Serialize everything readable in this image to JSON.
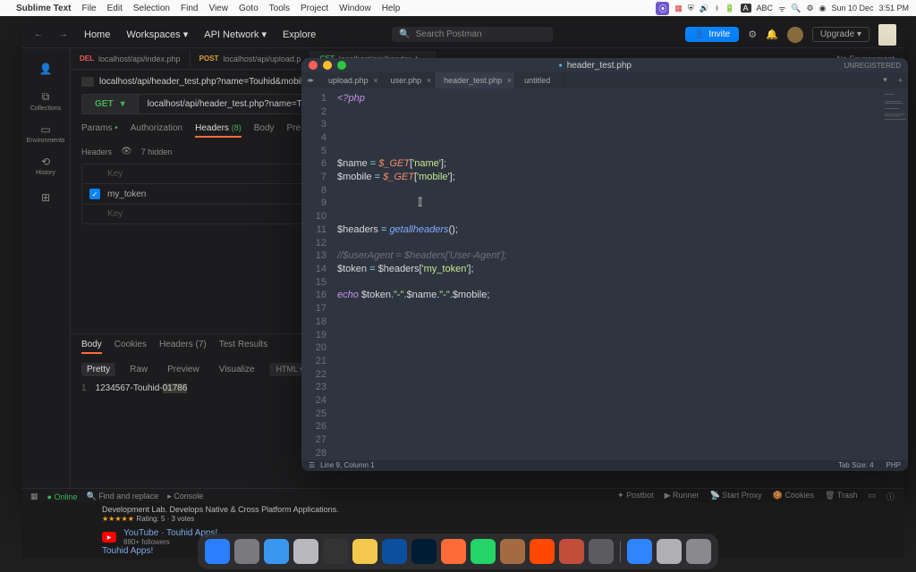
{
  "menubar": {
    "app": "Sublime Text",
    "items": [
      "File",
      "Edit",
      "Selection",
      "Find",
      "View",
      "Goto",
      "Tools",
      "Project",
      "Window",
      "Help"
    ],
    "date": "Sun 10 Dec",
    "time": "3:51 PM",
    "lang": "A",
    "input": "ABC"
  },
  "postman": {
    "nav": {
      "home": "Home",
      "workspaces": "Workspaces",
      "api": "API Network",
      "explore": "Explore"
    },
    "search_placeholder": "Search Postman",
    "invite": "Invite",
    "upgrade": "Upgrade",
    "sidebar": [
      {
        "glyph": "⧉",
        "label": "Collections"
      },
      {
        "glyph": "▭",
        "label": "Environments"
      },
      {
        "glyph": "⟲",
        "label": "History"
      },
      {
        "glyph": "⊞",
        "label": ""
      }
    ],
    "tabs": [
      {
        "method": "DEL",
        "cls": "method-del",
        "label": "localhost/api/index.php"
      },
      {
        "method": "POST",
        "cls": "method-post",
        "label": "localhost/api/upload.p"
      },
      {
        "method": "GET",
        "cls": "method-get",
        "label": "localhost/api/header_t…",
        "active": true
      }
    ],
    "env": "No Environment",
    "breadcrumb": "localhost/api/header_test.php?name=Touhid&mobile=01786",
    "method": "GET",
    "url": "localhost/api/header_test.php?name=Touhid&mobile=01786",
    "subtabs": [
      "Params",
      "Authorization",
      "Headers",
      "Body",
      "Pre-requ"
    ],
    "headers_count": "(8)",
    "headers_label": "Headers",
    "hidden_label": "7 hidden",
    "header_rows": [
      {
        "key_label": "Key",
        "placeholder": true,
        "checked": false
      },
      {
        "key_label": "my_token",
        "placeholder": false,
        "checked": true
      },
      {
        "key_label": "Key",
        "placeholder": true,
        "checked": false
      }
    ],
    "resp_tabs": [
      "Body",
      "Cookies",
      "Headers (7)",
      "Test Results"
    ],
    "resp_toolbar": {
      "pretty": "Pretty",
      "raw": "Raw",
      "preview": "Preview",
      "visualize": "Visualize",
      "format": "HTML"
    },
    "resp_body": {
      "line": "1",
      "text_a": "1234567-Touhid-",
      "text_hl": "01786"
    },
    "footer": {
      "online": "Online",
      "find": "Find and replace",
      "console": "Console",
      "postbot": "Postbot",
      "runner": "Runner",
      "proxy": "Start Proxy",
      "cookies": "Cookies",
      "trash": "Trash"
    }
  },
  "sublime": {
    "title_file": "header_test.php",
    "unreg": "UNREGISTERED",
    "tabs": [
      {
        "label": "upload.php",
        "active": false
      },
      {
        "label": "user.php",
        "active": false
      },
      {
        "label": "header_test.php",
        "active": true
      },
      {
        "label": "untitled",
        "active": false
      }
    ],
    "lines": [
      "1",
      "2",
      "3",
      "4",
      "5",
      "6",
      "7",
      "8",
      "9",
      "10",
      "11",
      "12",
      "13",
      "14",
      "15",
      "16",
      "17",
      "18",
      "19",
      "20",
      "21",
      "22",
      "23",
      "24",
      "25",
      "26",
      "27",
      "28"
    ],
    "code": {
      "l1_open": "<?php",
      "l6_var": "$name",
      "l6_get": "$_GET",
      "l6_key": "'name'",
      "l7_var": "$mobile",
      "l7_get": "$_GET",
      "l7_key": "'mobile'",
      "l11_var": "$headers",
      "l11_fn": "getallheaders",
      "l13": "//$userAgent = $headers['User-Agent'];",
      "l14_var": "$token",
      "l14_hd": "$headers",
      "l14_key": "'my_token'",
      "l16_echo": "echo",
      "l16_tk": "$token",
      "l16_s1": "\"-\"",
      "l16_nm": "$name",
      "l16_s2": "\"-\"",
      "l16_mb": "$mobile"
    },
    "status": {
      "pos": "Line 9, Column 1",
      "tab": "Tab Size: 4",
      "lang": "PHP"
    }
  },
  "browser": {
    "desc": "Development Lab. Develops Native & Cross Platform Applications.",
    "rating_text": "Rating: 5 · 3 votes",
    "yt_label": "YouTube · Touhid Apps!",
    "yt_sub": "880+ followers",
    "link": "Touhid Apps!"
  },
  "dock_colors": [
    "#2b7fff",
    "#7a7a7e",
    "#3a97f0",
    "#b8b8bd",
    "#333",
    "#f2c94c",
    "#0b4f9e",
    "#001d34",
    "#ff6c37",
    "#25d366",
    "#a46b42",
    "#ff4800",
    "#c14e3a",
    "#5b5b60",
    "#2f84ff",
    "#b0b0b3",
    "#8a8a8d"
  ]
}
